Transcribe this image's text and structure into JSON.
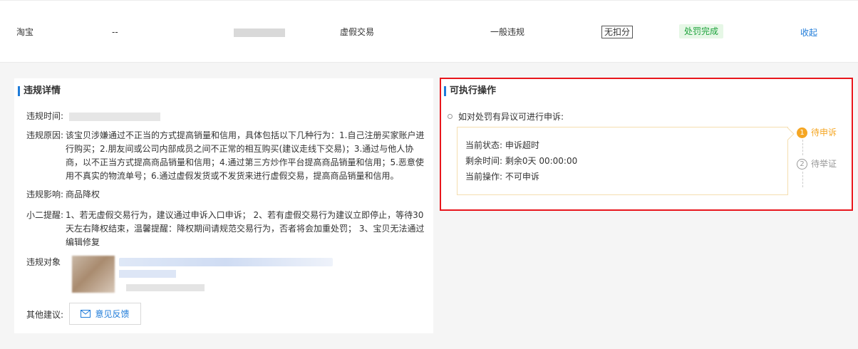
{
  "row": {
    "platform": "淘宝",
    "dash": "--",
    "type": "虚假交易",
    "level": "一般违规",
    "deduct_tag": "无扣分",
    "status_tag": "处罚完成",
    "collapse": "收起"
  },
  "details": {
    "title": "违规详情",
    "time_label": "违规时间:",
    "reason_label": "违规原因:",
    "reason_text": "该宝贝涉嫌通过不正当的方式提高销量和信用，具体包括以下几种行为：1.自己注册买家账户进行购买；2.朋友间或公司内部成员之间不正常的相互购买(建议走线下交易)；3.通过与他人协商，以不正当方式提高商品销量和信用；4.通过第三方炒作平台提高商品销量和信用；5.恶意使用不真实的物流单号；6.通过虚假发货或不发货来进行虚假交易，提高商品销量和信用。",
    "impact_label": "违规影响:",
    "impact_text": "商品降权",
    "tip_label": "小二提醒:",
    "tip_text": "1、若无虚假交易行为，建议通过申诉入口申诉； 2、若有虚假交易行为建议立即停止，等待30天左右降权结束，温馨提醒：降权期间请规范交易行为，否者将会加重处罚； 3、宝贝无法通过编辑修复",
    "object_label": "违规对象",
    "other_label": "其他建议:",
    "feedback_button": "意见反馈"
  },
  "actions": {
    "title": "可执行操作",
    "appeal_line": "如对处罚有异议可进行申诉:",
    "state_label": "当前状态:",
    "state_value": "申诉超时",
    "remain_label": "剩余时间:",
    "remain_value": "剩余0天 00:00:00",
    "op_label": "当前操作:",
    "op_value": "不可申诉",
    "steps": [
      {
        "num": "1",
        "label": "待申诉",
        "state": "active"
      },
      {
        "num": "2",
        "label": "待举证",
        "state": "pending"
      }
    ]
  },
  "colors": {
    "accent": "#1e7bd9",
    "success_bg": "#e6f7e6",
    "success_text": "#1fa33d",
    "warning": "#f5a623",
    "highlight_border": "#e8161c"
  }
}
